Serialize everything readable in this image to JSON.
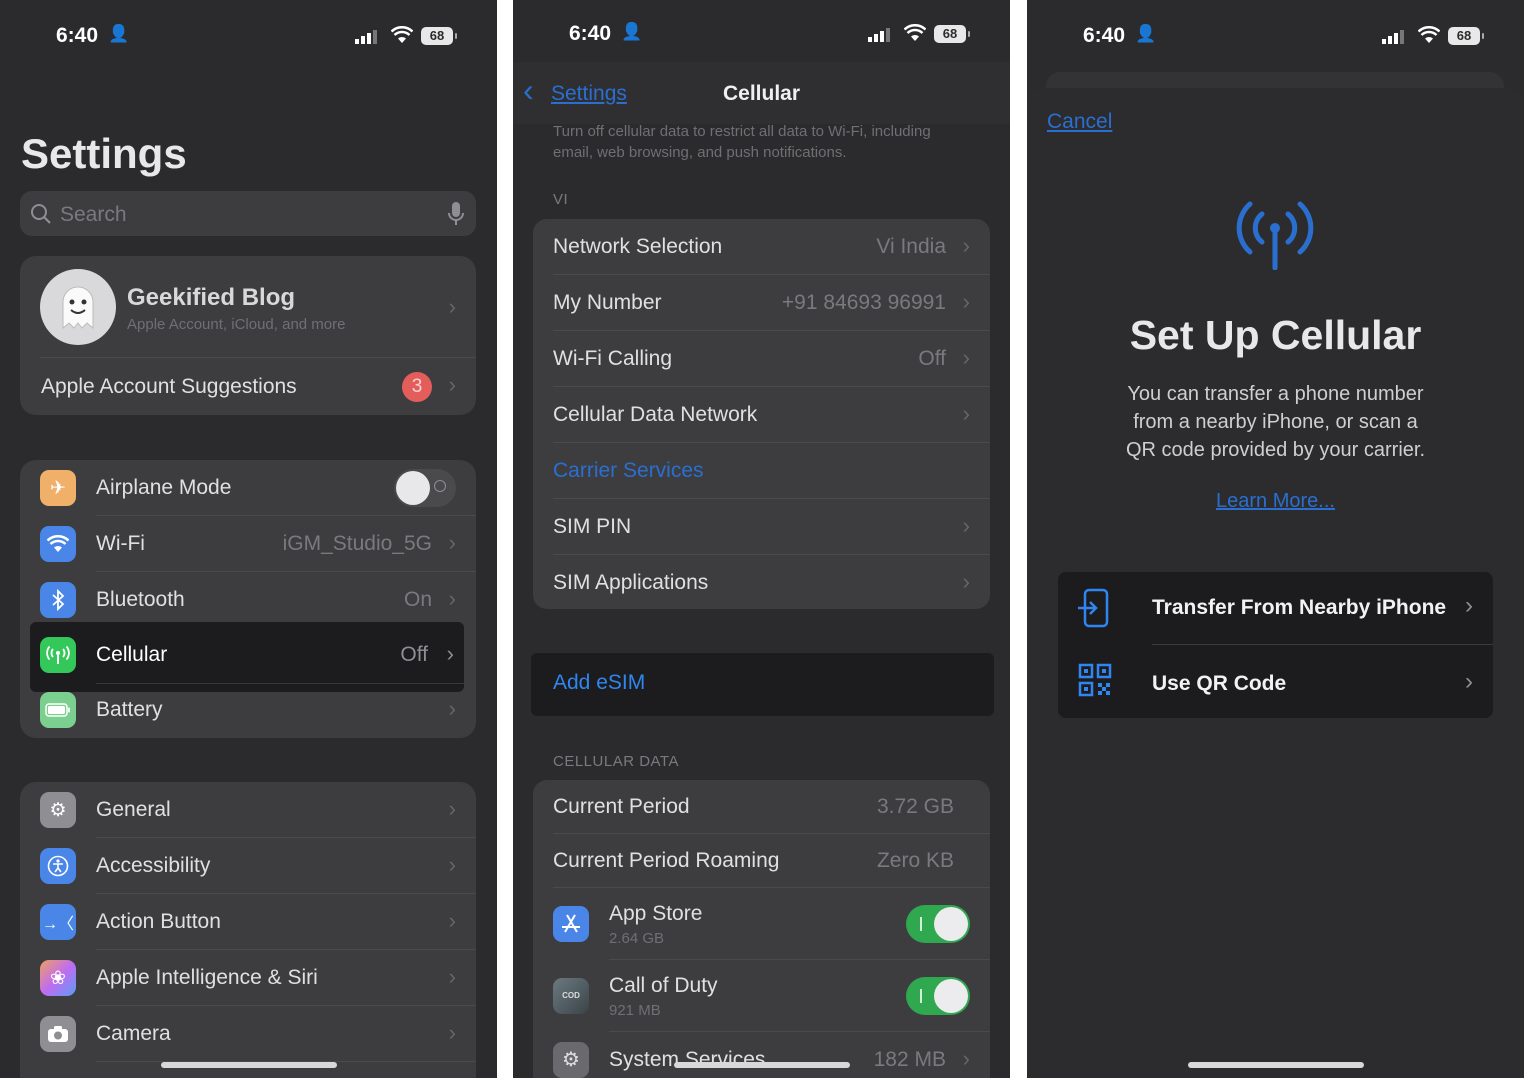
{
  "status": {
    "time": "6:40",
    "battery": "68"
  },
  "p1": {
    "title": "Settings",
    "search_placeholder": "Search",
    "account": {
      "name": "Geekified Blog",
      "sub": "Apple Account, iCloud, and more"
    },
    "suggestions": {
      "label": "Apple Account Suggestions",
      "badge": "3"
    },
    "connectivity": [
      {
        "label": "Airplane Mode",
        "icon": "airplane-icon",
        "color": "#f09a37"
      },
      {
        "label": "Wi-Fi",
        "value": "iGM_Studio_5G",
        "icon": "wifi-icon",
        "color": "#3478f6"
      },
      {
        "label": "Bluetooth",
        "value": "On",
        "icon": "bluetooth-icon",
        "color": "#3478f6"
      }
    ],
    "cellular": {
      "label": "Cellular",
      "value": "Off",
      "icon": "antenna-icon",
      "color": "#34c759"
    },
    "battery_row": {
      "label": "Battery",
      "icon": "battery-icon",
      "color": "#34c759"
    },
    "general_group": [
      {
        "label": "General",
        "icon": "gear-icon",
        "color": "#8e8e93"
      },
      {
        "label": "Accessibility",
        "icon": "accessibility-icon",
        "color": "#3478f6"
      },
      {
        "label": "Action Button",
        "icon": "action-button-icon",
        "color": "#3478f6"
      },
      {
        "label": "Apple Intelligence & Siri",
        "icon": "siri-icon",
        "color": "#c06cf0"
      },
      {
        "label": "Camera",
        "icon": "camera-icon",
        "color": "#8e8e93"
      }
    ]
  },
  "p2": {
    "back_label": "Settings",
    "title": "Cellular",
    "footer_text": "Turn off cellular data to restrict all data to Wi-Fi, including email, web browsing, and push notifications.",
    "carrier_header": "VI",
    "rows": [
      {
        "label": "Network Selection",
        "value": "Vi India"
      },
      {
        "label": "My Number",
        "value": "+91 84693 96991"
      },
      {
        "label": "Wi-Fi Calling",
        "value": "Off"
      },
      {
        "label": "Cellular Data Network",
        "value": ""
      },
      {
        "label": "Carrier Services",
        "value": ""
      },
      {
        "label": "SIM PIN",
        "value": ""
      },
      {
        "label": "SIM Applications",
        "value": ""
      }
    ],
    "add_esim": "Add eSIM",
    "data_header": "CELLULAR DATA",
    "period": {
      "label": "Current Period",
      "value": "3.72 GB"
    },
    "roaming": {
      "label": "Current Period Roaming",
      "value": "Zero KB"
    },
    "apps": [
      {
        "name": "App Store",
        "size": "2.64 GB",
        "icon": "app-store-icon"
      },
      {
        "name": "Call of Duty",
        "size": "921 MB",
        "icon": "call-of-duty-icon"
      }
    ],
    "system": {
      "label": "System Services",
      "value": "182 MB"
    }
  },
  "p3": {
    "cancel": "Cancel",
    "title": "Set Up Cellular",
    "desc": [
      "You can transfer a phone number",
      "from a nearby iPhone, or scan a",
      "QR code provided by your carrier."
    ],
    "learn_more": "Learn More...",
    "options": [
      {
        "label": "Transfer From Nearby iPhone",
        "icon": "transfer-icon"
      },
      {
        "label": "Use QR Code",
        "icon": "qr-code-icon"
      }
    ],
    "accent": "#1f7ae0"
  }
}
